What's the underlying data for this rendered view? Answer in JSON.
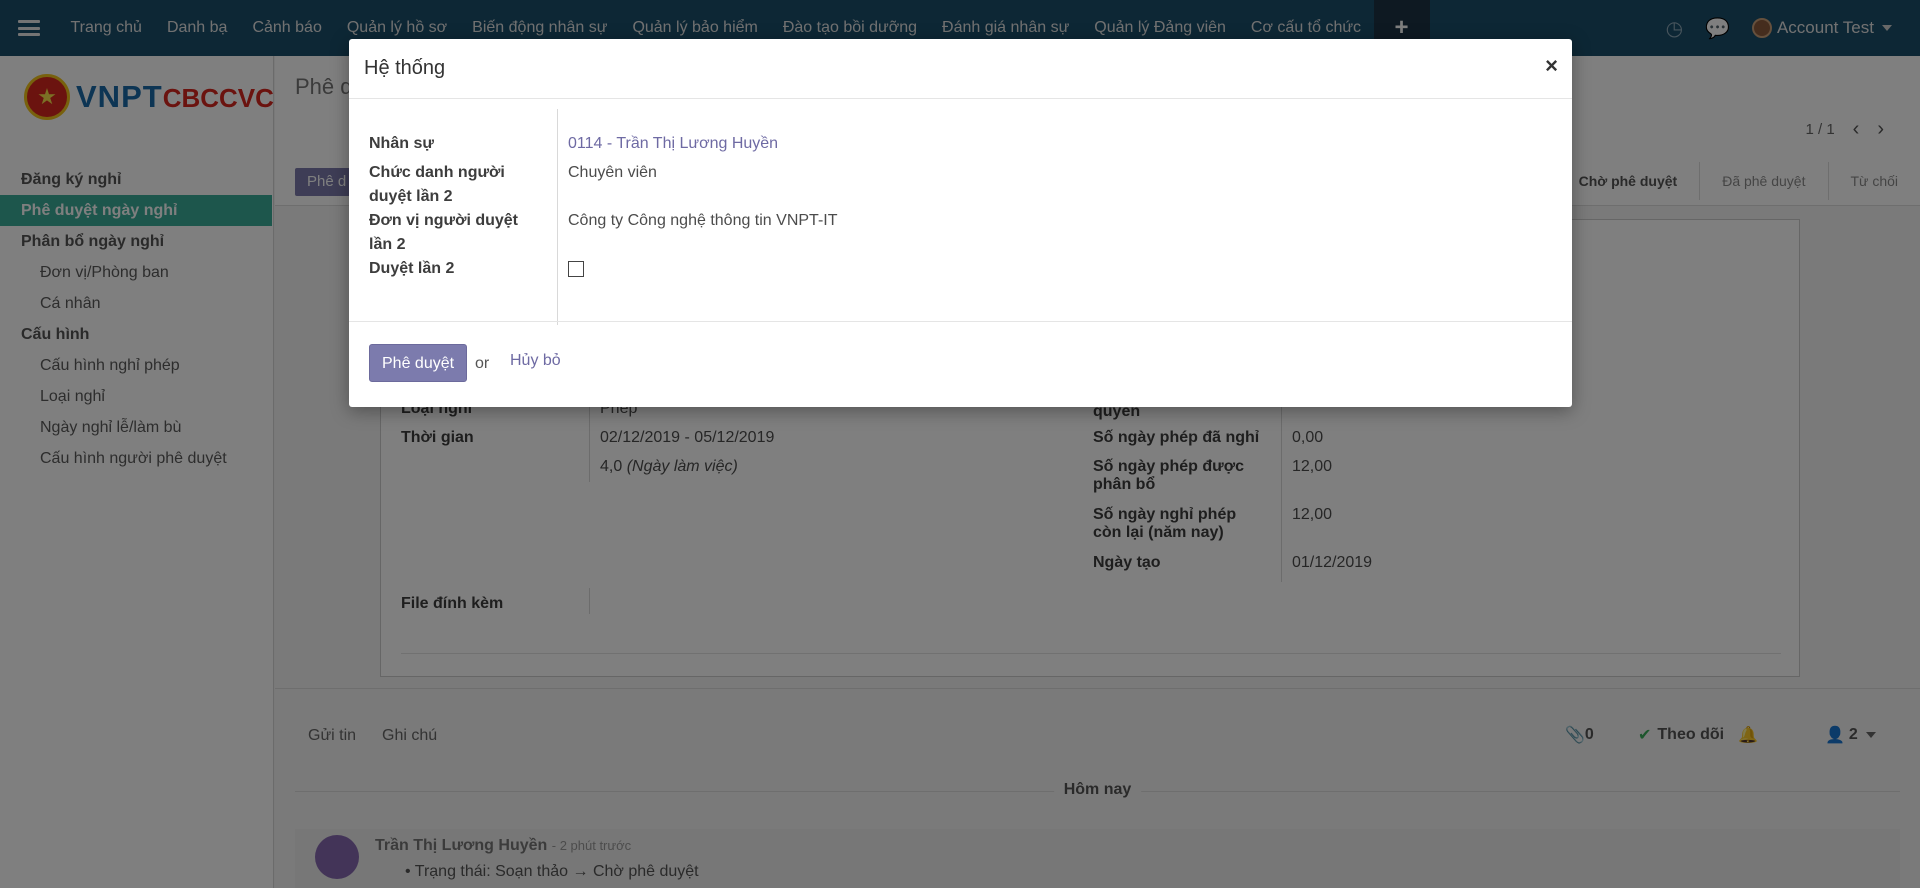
{
  "navbar": {
    "menu_icon": "hamburger-icon",
    "items": [
      "Trang chủ",
      "Danh bạ",
      "Cảnh báo",
      "Quản lý hồ sơ",
      "Biến động nhân sự",
      "Quản lý bảo hiểm",
      "Đào tạo bồi dưỡng",
      "Đánh giá nhân sự",
      "Quản lý Đảng viên",
      "Cơ cấu tổ chức"
    ],
    "plus": "+",
    "activity_icon": "clock-icon",
    "chat_icon": "chat-icon",
    "user_name": "Account Test"
  },
  "logo": {
    "part1": "VNPT",
    "part2": "CBCCVC"
  },
  "sidebar": {
    "items": [
      {
        "label": "Đăng ký nghỉ",
        "level": "cat"
      },
      {
        "label": "Phê duyệt ngày nghỉ",
        "level": "cat",
        "active": true
      },
      {
        "label": "Phân bổ ngày nghỉ",
        "level": "cat"
      },
      {
        "label": "Đơn vị/Phòng ban",
        "level": "sub"
      },
      {
        "label": "Cá nhân",
        "level": "sub"
      },
      {
        "label": "Cấu hình",
        "level": "cat"
      },
      {
        "label": "Cấu hình nghỉ phép",
        "level": "sub"
      },
      {
        "label": "Loại nghỉ",
        "level": "sub"
      },
      {
        "label": "Ngày nghỉ lễ/làm bù",
        "level": "sub"
      },
      {
        "label": "Cấu hình người phê duyệt",
        "level": "sub"
      }
    ]
  },
  "main": {
    "breadcrumb": "Phê d",
    "pager": "1 / 1",
    "approve_button": "Phê d",
    "status_steps": [
      "Chờ phê duyệt",
      "Đã phê duyệt",
      "Từ chối"
    ],
    "form": {
      "loai_nghi_label": "Loại nghỉ",
      "loai_nghi_value": "Phép",
      "thoi_gian_label": "Thời gian",
      "thoi_gian_value": "02/12/2019 - 05/12/2019",
      "duration_value": "4,0",
      "duration_unit": "(Ngày làm việc)",
      "file_label": "File đính kèm",
      "quyen_fragment": "quyền",
      "r1_label": "Số ngày phép đã nghỉ",
      "r1_value": "0,00",
      "r2_label_a": "Số ngày phép được",
      "r2_label_b": "phân bổ",
      "r2_value": "12,00",
      "r3_label_a": "Số ngày nghỉ phép",
      "r3_label_b": "còn lại (năm nay)",
      "r3_value": "12,00",
      "r4_label": "Ngày tạo",
      "r4_value": "01/12/2019"
    }
  },
  "chatter": {
    "send_tab": "Gửi tin",
    "note_tab": "Ghi chú",
    "attachments": "0",
    "follow": "Theo dõi",
    "followers": "2",
    "day": "Hôm nay",
    "author": "Trần Thị Lương Huyền",
    "time": "- 2 phút trước",
    "tracking": "Trạng thái: Soạn thảo → Chờ phê duyệt"
  },
  "modal": {
    "title": "Hệ thống",
    "close": "×",
    "nhan_su_label": "Nhân sự",
    "nhan_su_value": "0114 - Trần Thị Lương Huyền",
    "chuc_danh_label_a": "Chức danh người",
    "chuc_danh_label_b": "duyệt lần 2",
    "chuc_danh_value": "Chuyên viên",
    "don_vi_label_a": "Đơn vị người duyệt",
    "don_vi_label_b": "lần 2",
    "don_vi_value": "Công ty Công nghệ thông tin VNPT-IT",
    "duyet_label": "Duyệt lần 2",
    "duyet_checked": false,
    "approve_button": "Phê duyệt",
    "or": "or",
    "cancel": "Hủy bỏ"
  }
}
